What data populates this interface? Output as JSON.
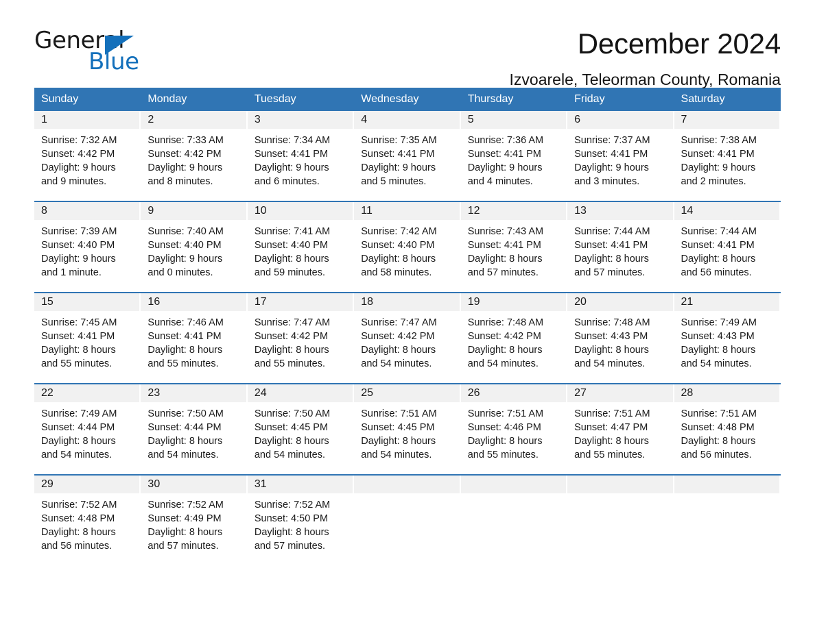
{
  "logo": {
    "text_dark": "General",
    "text_blue": "Blue",
    "triangle": "triangle-mark",
    "blue": "#1470bb"
  },
  "header": {
    "month_title": "December 2024",
    "location": "Izvoarele, Teleorman County, Romania"
  },
  "theme": {
    "header_blue": "#3075b4",
    "daynum_band": "#f1f1f1",
    "text": "#1a1a1a"
  },
  "calendar": {
    "weekdays": [
      "Sunday",
      "Monday",
      "Tuesday",
      "Wednesday",
      "Thursday",
      "Friday",
      "Saturday"
    ],
    "weeks": [
      [
        {
          "day": "1",
          "sunrise": "Sunrise: 7:32 AM",
          "sunset": "Sunset: 4:42 PM",
          "daylight_1": "Daylight: 9 hours",
          "daylight_2": "and 9 minutes."
        },
        {
          "day": "2",
          "sunrise": "Sunrise: 7:33 AM",
          "sunset": "Sunset: 4:42 PM",
          "daylight_1": "Daylight: 9 hours",
          "daylight_2": "and 8 minutes."
        },
        {
          "day": "3",
          "sunrise": "Sunrise: 7:34 AM",
          "sunset": "Sunset: 4:41 PM",
          "daylight_1": "Daylight: 9 hours",
          "daylight_2": "and 6 minutes."
        },
        {
          "day": "4",
          "sunrise": "Sunrise: 7:35 AM",
          "sunset": "Sunset: 4:41 PM",
          "daylight_1": "Daylight: 9 hours",
          "daylight_2": "and 5 minutes."
        },
        {
          "day": "5",
          "sunrise": "Sunrise: 7:36 AM",
          "sunset": "Sunset: 4:41 PM",
          "daylight_1": "Daylight: 9 hours",
          "daylight_2": "and 4 minutes."
        },
        {
          "day": "6",
          "sunrise": "Sunrise: 7:37 AM",
          "sunset": "Sunset: 4:41 PM",
          "daylight_1": "Daylight: 9 hours",
          "daylight_2": "and 3 minutes."
        },
        {
          "day": "7",
          "sunrise": "Sunrise: 7:38 AM",
          "sunset": "Sunset: 4:41 PM",
          "daylight_1": "Daylight: 9 hours",
          "daylight_2": "and 2 minutes."
        }
      ],
      [
        {
          "day": "8",
          "sunrise": "Sunrise: 7:39 AM",
          "sunset": "Sunset: 4:40 PM",
          "daylight_1": "Daylight: 9 hours",
          "daylight_2": "and 1 minute."
        },
        {
          "day": "9",
          "sunrise": "Sunrise: 7:40 AM",
          "sunset": "Sunset: 4:40 PM",
          "daylight_1": "Daylight: 9 hours",
          "daylight_2": "and 0 minutes."
        },
        {
          "day": "10",
          "sunrise": "Sunrise: 7:41 AM",
          "sunset": "Sunset: 4:40 PM",
          "daylight_1": "Daylight: 8 hours",
          "daylight_2": "and 59 minutes."
        },
        {
          "day": "11",
          "sunrise": "Sunrise: 7:42 AM",
          "sunset": "Sunset: 4:40 PM",
          "daylight_1": "Daylight: 8 hours",
          "daylight_2": "and 58 minutes."
        },
        {
          "day": "12",
          "sunrise": "Sunrise: 7:43 AM",
          "sunset": "Sunset: 4:41 PM",
          "daylight_1": "Daylight: 8 hours",
          "daylight_2": "and 57 minutes."
        },
        {
          "day": "13",
          "sunrise": "Sunrise: 7:44 AM",
          "sunset": "Sunset: 4:41 PM",
          "daylight_1": "Daylight: 8 hours",
          "daylight_2": "and 57 minutes."
        },
        {
          "day": "14",
          "sunrise": "Sunrise: 7:44 AM",
          "sunset": "Sunset: 4:41 PM",
          "daylight_1": "Daylight: 8 hours",
          "daylight_2": "and 56 minutes."
        }
      ],
      [
        {
          "day": "15",
          "sunrise": "Sunrise: 7:45 AM",
          "sunset": "Sunset: 4:41 PM",
          "daylight_1": "Daylight: 8 hours",
          "daylight_2": "and 55 minutes."
        },
        {
          "day": "16",
          "sunrise": "Sunrise: 7:46 AM",
          "sunset": "Sunset: 4:41 PM",
          "daylight_1": "Daylight: 8 hours",
          "daylight_2": "and 55 minutes."
        },
        {
          "day": "17",
          "sunrise": "Sunrise: 7:47 AM",
          "sunset": "Sunset: 4:42 PM",
          "daylight_1": "Daylight: 8 hours",
          "daylight_2": "and 55 minutes."
        },
        {
          "day": "18",
          "sunrise": "Sunrise: 7:47 AM",
          "sunset": "Sunset: 4:42 PM",
          "daylight_1": "Daylight: 8 hours",
          "daylight_2": "and 54 minutes."
        },
        {
          "day": "19",
          "sunrise": "Sunrise: 7:48 AM",
          "sunset": "Sunset: 4:42 PM",
          "daylight_1": "Daylight: 8 hours",
          "daylight_2": "and 54 minutes."
        },
        {
          "day": "20",
          "sunrise": "Sunrise: 7:48 AM",
          "sunset": "Sunset: 4:43 PM",
          "daylight_1": "Daylight: 8 hours",
          "daylight_2": "and 54 minutes."
        },
        {
          "day": "21",
          "sunrise": "Sunrise: 7:49 AM",
          "sunset": "Sunset: 4:43 PM",
          "daylight_1": "Daylight: 8 hours",
          "daylight_2": "and 54 minutes."
        }
      ],
      [
        {
          "day": "22",
          "sunrise": "Sunrise: 7:49 AM",
          "sunset": "Sunset: 4:44 PM",
          "daylight_1": "Daylight: 8 hours",
          "daylight_2": "and 54 minutes."
        },
        {
          "day": "23",
          "sunrise": "Sunrise: 7:50 AM",
          "sunset": "Sunset: 4:44 PM",
          "daylight_1": "Daylight: 8 hours",
          "daylight_2": "and 54 minutes."
        },
        {
          "day": "24",
          "sunrise": "Sunrise: 7:50 AM",
          "sunset": "Sunset: 4:45 PM",
          "daylight_1": "Daylight: 8 hours",
          "daylight_2": "and 54 minutes."
        },
        {
          "day": "25",
          "sunrise": "Sunrise: 7:51 AM",
          "sunset": "Sunset: 4:45 PM",
          "daylight_1": "Daylight: 8 hours",
          "daylight_2": "and 54 minutes."
        },
        {
          "day": "26",
          "sunrise": "Sunrise: 7:51 AM",
          "sunset": "Sunset: 4:46 PM",
          "daylight_1": "Daylight: 8 hours",
          "daylight_2": "and 55 minutes."
        },
        {
          "day": "27",
          "sunrise": "Sunrise: 7:51 AM",
          "sunset": "Sunset: 4:47 PM",
          "daylight_1": "Daylight: 8 hours",
          "daylight_2": "and 55 minutes."
        },
        {
          "day": "28",
          "sunrise": "Sunrise: 7:51 AM",
          "sunset": "Sunset: 4:48 PM",
          "daylight_1": "Daylight: 8 hours",
          "daylight_2": "and 56 minutes."
        }
      ],
      [
        {
          "day": "29",
          "sunrise": "Sunrise: 7:52 AM",
          "sunset": "Sunset: 4:48 PM",
          "daylight_1": "Daylight: 8 hours",
          "daylight_2": "and 56 minutes."
        },
        {
          "day": "30",
          "sunrise": "Sunrise: 7:52 AM",
          "sunset": "Sunset: 4:49 PM",
          "daylight_1": "Daylight: 8 hours",
          "daylight_2": "and 57 minutes."
        },
        {
          "day": "31",
          "sunrise": "Sunrise: 7:52 AM",
          "sunset": "Sunset: 4:50 PM",
          "daylight_1": "Daylight: 8 hours",
          "daylight_2": "and 57 minutes."
        },
        {
          "day": "",
          "sunrise": "",
          "sunset": "",
          "daylight_1": "",
          "daylight_2": ""
        },
        {
          "day": "",
          "sunrise": "",
          "sunset": "",
          "daylight_1": "",
          "daylight_2": ""
        },
        {
          "day": "",
          "sunrise": "",
          "sunset": "",
          "daylight_1": "",
          "daylight_2": ""
        },
        {
          "day": "",
          "sunrise": "",
          "sunset": "",
          "daylight_1": "",
          "daylight_2": ""
        }
      ]
    ]
  }
}
